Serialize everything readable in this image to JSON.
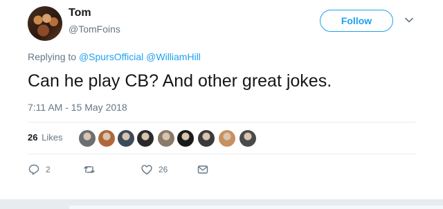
{
  "user": {
    "name": "Tom",
    "handle": "@TomFoins"
  },
  "follow_label": "Follow",
  "reply": {
    "prefix": "Replying to",
    "mentions": [
      "@SpursOfficial",
      "@WilliamHill"
    ]
  },
  "text": "Can he play CB? And other great jokes.",
  "timestamp": "7:11 AM - 15 May 2018",
  "likes": {
    "count": "26",
    "label": "Likes",
    "avatar_colors": [
      "#6b6f73",
      "#b0683a",
      "#3c4a5a",
      "#2a2a2a",
      "#8a7a6a",
      "#1a1a1a",
      "#3a3a3a",
      "#c89060",
      "#4a4a4a"
    ]
  },
  "actions": {
    "reply_count": "2",
    "retweet_count": "",
    "like_count": "26"
  },
  "colors": {
    "accent": "#1da1f2",
    "secondary_text": "#657786",
    "divider": "#e6ecf0"
  },
  "icons": [
    "chevron-down-icon",
    "reply-icon",
    "retweet-icon",
    "heart-icon",
    "message-icon"
  ]
}
